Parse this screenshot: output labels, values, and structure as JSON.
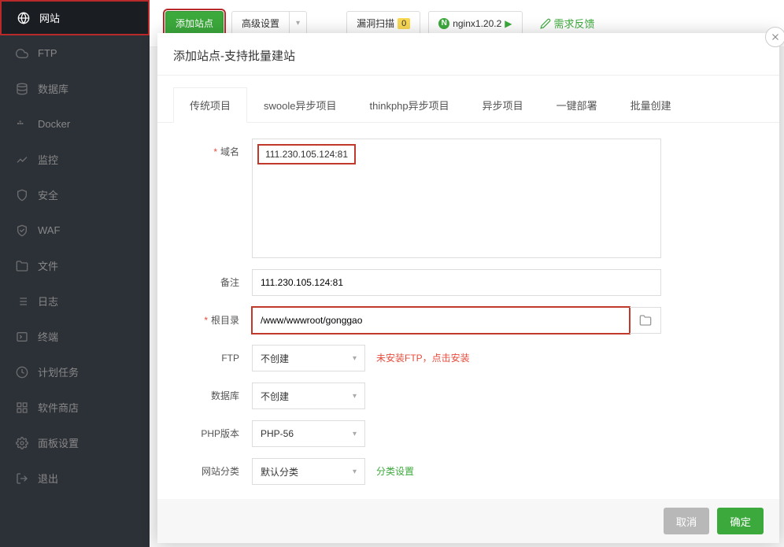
{
  "sidebar": {
    "items": [
      {
        "label": "网站",
        "icon": "globe-icon"
      },
      {
        "label": "FTP",
        "icon": "cloud-icon"
      },
      {
        "label": "数据库",
        "icon": "database-icon"
      },
      {
        "label": "Docker",
        "icon": "docker-icon"
      },
      {
        "label": "监控",
        "icon": "chart-icon"
      },
      {
        "label": "安全",
        "icon": "shield-icon"
      },
      {
        "label": "WAF",
        "icon": "waf-icon"
      },
      {
        "label": "文件",
        "icon": "folder-icon"
      },
      {
        "label": "日志",
        "icon": "list-icon"
      },
      {
        "label": "终端",
        "icon": "terminal-icon"
      },
      {
        "label": "计划任务",
        "icon": "clock-icon"
      },
      {
        "label": "软件商店",
        "icon": "grid-icon"
      },
      {
        "label": "面板设置",
        "icon": "gear-icon"
      },
      {
        "label": "退出",
        "icon": "exit-icon"
      }
    ]
  },
  "topbar": {
    "add_site": "添加站点",
    "advanced": "高级设置",
    "scan": "漏洞扫描",
    "scan_badge": "0",
    "nginx": "nginx1.20.2",
    "feedback": "需求反馈"
  },
  "modal": {
    "title": "添加站点-支持批量建站",
    "tabs": [
      "传统项目",
      "swoole异步项目",
      "thinkphp异步项目",
      "异步项目",
      "一键部署",
      "批量创建"
    ],
    "labels": {
      "domain": "域名",
      "remark": "备注",
      "root": "根目录",
      "ftp": "FTP",
      "database": "数据库",
      "php": "PHP版本",
      "category": "网站分类"
    },
    "values": {
      "domain": "111.230.105.124:81",
      "remark": "111.230.105.124:81",
      "root": "/www/wwwroot/gonggao",
      "ftp": "不创建",
      "database": "不创建",
      "php": "PHP-56",
      "category": "默认分类"
    },
    "hints": {
      "ftp_warning": "未安装FTP，点击安装",
      "category_link": "分类设置"
    },
    "cancel": "取消",
    "confirm": "确定"
  }
}
